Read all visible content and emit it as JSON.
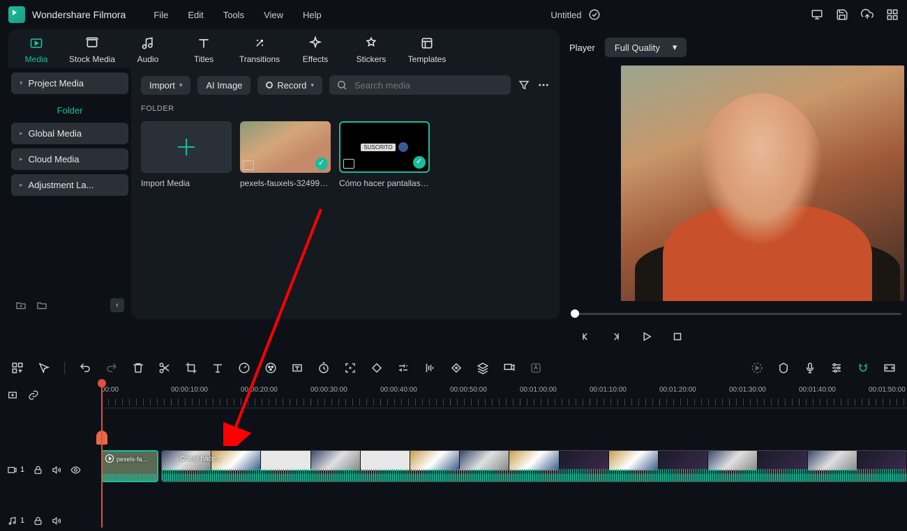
{
  "app": {
    "title": "Wondershare Filmora",
    "project": "Untitled"
  },
  "menu": {
    "file": "File",
    "edit": "Edit",
    "tools": "Tools",
    "view": "View",
    "help": "Help"
  },
  "tabs": {
    "media": "Media",
    "stock": "Stock Media",
    "audio": "Audio",
    "titles": "Titles",
    "transitions": "Transitions",
    "effects": "Effects",
    "stickers": "Stickers",
    "templates": "Templates"
  },
  "left_panel": {
    "project_media": "Project Media",
    "folder": "Folder",
    "global": "Global Media",
    "cloud": "Cloud Media",
    "adjustment": "Adjustment La..."
  },
  "media_tb": {
    "import": "Import",
    "ai_image": "AI Image",
    "record": "Record",
    "search_placeholder": "Search media"
  },
  "folder_header": "FOLDER",
  "media_items": {
    "import_label": "Import Media",
    "clip1": "pexels-fauxels-324993...",
    "clip2": "Cómo hacer pantallas ...",
    "sub_badge": "SUSCRITO"
  },
  "preview": {
    "player": "Player",
    "quality": "Full Quality"
  },
  "timeline": {
    "ticks": [
      "00:00",
      "00:00:10:00",
      "00:00:20:00",
      "00:00:30:00",
      "00:00:40:00",
      "00:00:50:00",
      "00:01:00:00",
      "00:01:10:00",
      "00:01:20:00",
      "00:01:30:00",
      "00:01:40:00",
      "00:01:50:00"
    ],
    "clip_small_label": "pexels-fa...",
    "clip_big_label": "Cómo hace...",
    "track1_num": "1",
    "audio_num": "1"
  }
}
